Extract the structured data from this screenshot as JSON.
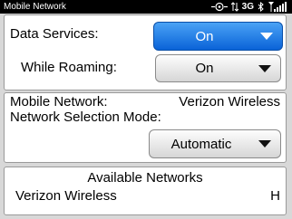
{
  "statusbar": {
    "title": "Mobile Network",
    "network_type": "3G",
    "icons": [
      "gps-icon",
      "network-arrows-icon",
      "bluetooth-icon",
      "signal-strength-icon"
    ]
  },
  "data_panel": {
    "data_services_label": "Data Services:",
    "data_services_value": "On",
    "while_roaming_label": "While Roaming:",
    "while_roaming_value": "On"
  },
  "network_panel": {
    "mobile_network_label": "Mobile Network:",
    "mobile_network_value": "Verizon Wireless",
    "selection_mode_label": "Network Selection Mode:",
    "selection_mode_value": "Automatic"
  },
  "available_networks": {
    "title": "Available Networks",
    "items": [
      {
        "name": "Verizon Wireless",
        "tech": "H"
      }
    ]
  },
  "colors": {
    "focus_blue": "#0a63d8",
    "background": "#d8d8d8",
    "panel": "#ffffff"
  }
}
